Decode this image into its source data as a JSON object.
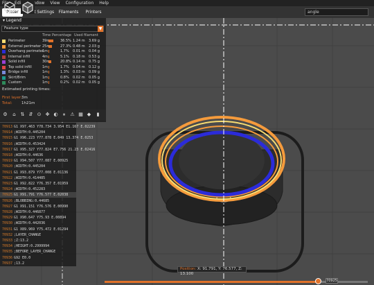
{
  "menu": [
    "File",
    "Edit",
    "Window",
    "View",
    "Configuration",
    "Help"
  ],
  "tabs": [
    "Plater",
    "Print Settings",
    "Filaments",
    "Printers"
  ],
  "search_value": "angle",
  "legend": {
    "title": "Legend",
    "feature_type": "Feature type",
    "columns": {
      "time": "Time",
      "percentage": "Percentage",
      "used": "Used filament"
    },
    "rows": [
      {
        "name": "Perimeter",
        "time": "39m",
        "pct": "36.5%",
        "len": "1.24 m",
        "g": "3.69 g",
        "color": "#f7dc72",
        "fill": 0.365
      },
      {
        "name": "External perimeter",
        "time": "25m",
        "pct": "27.3%",
        "len": "0.48 m",
        "g": "2.03 g",
        "color": "#f59b3c",
        "fill": 0.273
      },
      {
        "name": "Overhang perimeter",
        "time": "1m",
        "pct": "1.7%",
        "len": "0.01 m",
        "g": "0.04 g",
        "color": "#2b2bd9",
        "fill": 0.017
      },
      {
        "name": "Internal infill",
        "time": "4m",
        "pct": "5.1%",
        "len": "0.18 m",
        "g": "0.53 g",
        "color": "#b13f3f",
        "fill": 0.051
      },
      {
        "name": "Solid infill",
        "time": "30m",
        "pct": "20.8%",
        "len": "0.14 m",
        "g": "0.75 g",
        "color": "#9a40d6",
        "fill": 0.208
      },
      {
        "name": "Top solid infill",
        "time": "1m",
        "pct": "1.7%",
        "len": "0.04 m",
        "g": "0.12 g",
        "color": "#e04545",
        "fill": 0.017
      },
      {
        "name": "Bridge infill",
        "time": "1m",
        "pct": "1.3%",
        "len": "0.03 m",
        "g": "0.09 g",
        "color": "#7a8ad9",
        "fill": 0.013
      },
      {
        "name": "Skirt/Brim",
        "time": "1m",
        "pct": "0.8%",
        "len": "0.02 m",
        "g": "0.05 g",
        "color": "#1a9a8a",
        "fill": 0.008
      },
      {
        "name": "Custom",
        "time": "1m",
        "pct": "0.2%",
        "len": "0.02 m",
        "g": "0.05 g",
        "color": "#2e8a5a",
        "fill": 0.002
      }
    ],
    "estimated_title": "Estimated printing times:",
    "first_layer_label": "First layer:",
    "first_layer_value": "3m",
    "total_label": "Total:",
    "total_value": "1h21m"
  },
  "gcode": [
    {
      "n": "70913",
      "c": "G1 X97.463 Y78.734 3.954 E1.167 E.02239"
    },
    {
      "n": "70914",
      "c": ";WIDTH:0.445204"
    },
    {
      "n": "70915",
      "c": "G1 X96.223 Y77.878 E.049 13.374 E.0253"
    },
    {
      "n": "70916",
      "c": ";WIDTH:0.453424"
    },
    {
      "n": "70917",
      "c": "G1 X95.327 Y77.824 E7.756 21.23 E.02416"
    },
    {
      "n": "70918",
      "c": ";WIDTH:0.44636"
    },
    {
      "n": "70919",
      "c": "G1 X94.507 Y77.087 E.00925"
    },
    {
      "n": "70920",
      "c": ";WIDTH:0.445204"
    },
    {
      "n": "70921",
      "c": "G1 X93.879 Y77.008 E.01136"
    },
    {
      "n": "70922",
      "c": ";WIDTH:0.414485"
    },
    {
      "n": "70923",
      "c": "G1 X92.822 Y76.357 E.01959"
    },
    {
      "n": "70924",
      "c": ";WIDTH:0.452283"
    },
    {
      "n": "70925",
      "c": "G1 X91.791 Y76.577 E.02038"
    },
    {
      "n": "70926",
      "c": ";BLOBBING:0.44685"
    },
    {
      "n": "70927",
      "c": "G1 X91.151 Y76.576 E.00990"
    },
    {
      "n": "70928",
      "c": ";WIDTH:0.446877"
    },
    {
      "n": "70929",
      "c": "G1 X90.647 Y75.93 E.00894"
    },
    {
      "n": "70930",
      "c": ";WIDTH:0.442036"
    },
    {
      "n": "70931",
      "c": "G1 X89.969 Y75.472 E.01294"
    },
    {
      "n": "70932",
      "c": ";LAYER_CHANGE"
    },
    {
      "n": "70933",
      "c": ";Z:13.2"
    },
    {
      "n": "70934",
      "c": ";HEIGHT:0.2999994"
    },
    {
      "n": "70935",
      "c": ";BEFORE_LAYER_CHANGE"
    },
    {
      "n": "70936",
      "c": "G92 E0.0"
    },
    {
      "n": "70937",
      "c": ";13.2"
    }
  ],
  "position": "X: 91.791, Y: 76.577, Z: 13.100",
  "layer_label": "70925",
  "slider_fraction": 0.81,
  "colors": {
    "accent": "#e0722a",
    "bg": "#4b4b4b"
  }
}
